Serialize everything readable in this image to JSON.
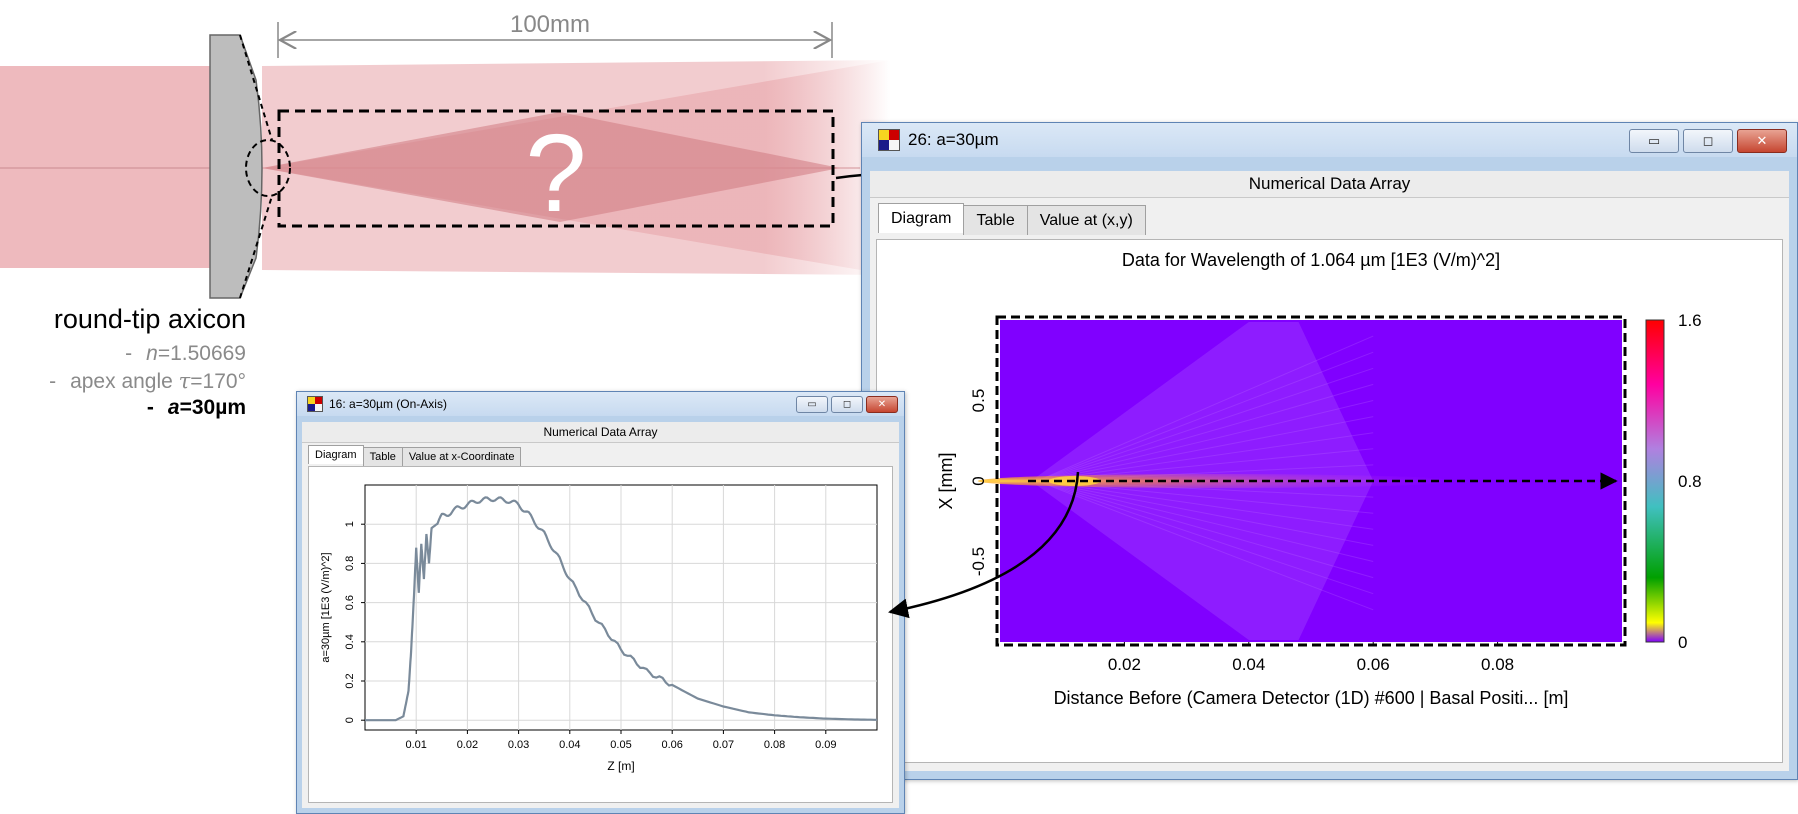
{
  "scene": {
    "dimension_label": "100mm",
    "question_mark": "?",
    "colors": {
      "beam": "#e8a3a8",
      "beam_dark": "#cf7a82",
      "lens": "#bdbdbd",
      "dash": "#000000"
    }
  },
  "caption": {
    "title": "round-tip axicon",
    "items": [
      {
        "dash": "-",
        "symbol": "n",
        "text": "=1.50669"
      },
      {
        "dash": "-",
        "text": "apex angle ",
        "symbol": "τ",
        "text2": "=170°"
      },
      {
        "dash": "-",
        "symbol": "a",
        "text": "=30µm"
      }
    ]
  },
  "window_main": {
    "title": "26: a=30µm",
    "subtitle": "Numerical Data Array",
    "buttons": {
      "minimize": "▭",
      "maximize": "◻",
      "close": "✕"
    },
    "tabs": [
      {
        "label": "Diagram",
        "active": true
      },
      {
        "label": "Table",
        "active": false
      },
      {
        "label": "Value at (x,y)",
        "active": false
      }
    ]
  },
  "window_onaxis": {
    "title": "16: a=30µm (On-Axis)",
    "subtitle": "Numerical Data Array",
    "buttons": {
      "minimize": "▭",
      "maximize": "◻",
      "close": "✕"
    },
    "tabs": [
      {
        "label": "Diagram",
        "active": true
      },
      {
        "label": "Table",
        "active": false
      },
      {
        "label": "Value at x-Coordinate",
        "active": false
      }
    ]
  },
  "chart_data": [
    {
      "type": "heatmap",
      "title": "Data for Wavelength of 1.064 µm  [1E3 (V/m)^2]",
      "xlabel": "Distance Before (Camera Detector (1D) #600 | Basal Positi... [m]",
      "ylabel": "X [mm]",
      "xlim": [
        0,
        0.1
      ],
      "ylim": [
        -1,
        1
      ],
      "xticks": [
        0.02,
        0.04,
        0.06,
        0.08
      ],
      "xtick_labels": [
        "0.02",
        "0.04",
        "0.06",
        "0.08"
      ],
      "yticks": [
        0.5,
        0,
        -0.5
      ],
      "ytick_labels": [
        "0.5",
        "0",
        "-0.5"
      ],
      "colorbar": {
        "min": 0,
        "max": 1.6,
        "labels": [
          "1.6",
          "0.8",
          "0"
        ]
      },
      "background_color": "#8000ff"
    },
    {
      "type": "line",
      "title": "",
      "xlabel": "Z [m]",
      "ylabel": "a=30µm [1E3 (V/m)^2]",
      "xlim": [
        0,
        0.1
      ],
      "ylim": [
        -0.05,
        1.2
      ],
      "xticks": [
        0.01,
        0.02,
        0.03,
        0.04,
        0.05,
        0.06,
        0.07,
        0.08,
        0.09
      ],
      "xtick_labels": [
        "0.01",
        "0.02",
        "0.03",
        "0.04",
        "0.05",
        "0.06",
        "0.07",
        "0.08",
        "0.09"
      ],
      "yticks": [
        0,
        0.2,
        0.4,
        0.6,
        0.8,
        1
      ],
      "ytick_labels": [
        "0",
        "0.2",
        "0.4",
        "0.6",
        "0.8",
        "1"
      ],
      "grid": true,
      "line_color": "#7a8a9a",
      "series": [
        {
          "x": [
            0,
            0.006,
            0.0075,
            0.0085,
            0.009,
            0.0095,
            0.01,
            0.0105,
            0.011,
            0.0115,
            0.012,
            0.0125,
            0.013,
            0.014,
            0.015,
            0.016,
            0.018,
            0.02,
            0.022,
            0.025,
            0.028,
            0.03,
            0.032,
            0.035,
            0.038,
            0.04,
            0.045,
            0.05,
            0.055,
            0.06,
            0.065,
            0.07,
            0.075,
            0.08,
            0.085,
            0.09,
            0.095,
            0.1
          ],
          "y": [
            0,
            0,
            0.02,
            0.15,
            0.35,
            0.6,
            0.88,
            0.65,
            0.9,
            0.72,
            0.95,
            0.8,
            0.98,
            1.0,
            1.04,
            1.05,
            1.08,
            1.1,
            1.12,
            1.13,
            1.12,
            1.1,
            1.05,
            0.95,
            0.82,
            0.72,
            0.52,
            0.36,
            0.25,
            0.18,
            0.11,
            0.07,
            0.04,
            0.025,
            0.015,
            0.008,
            0.004,
            0.002
          ]
        }
      ]
    }
  ]
}
